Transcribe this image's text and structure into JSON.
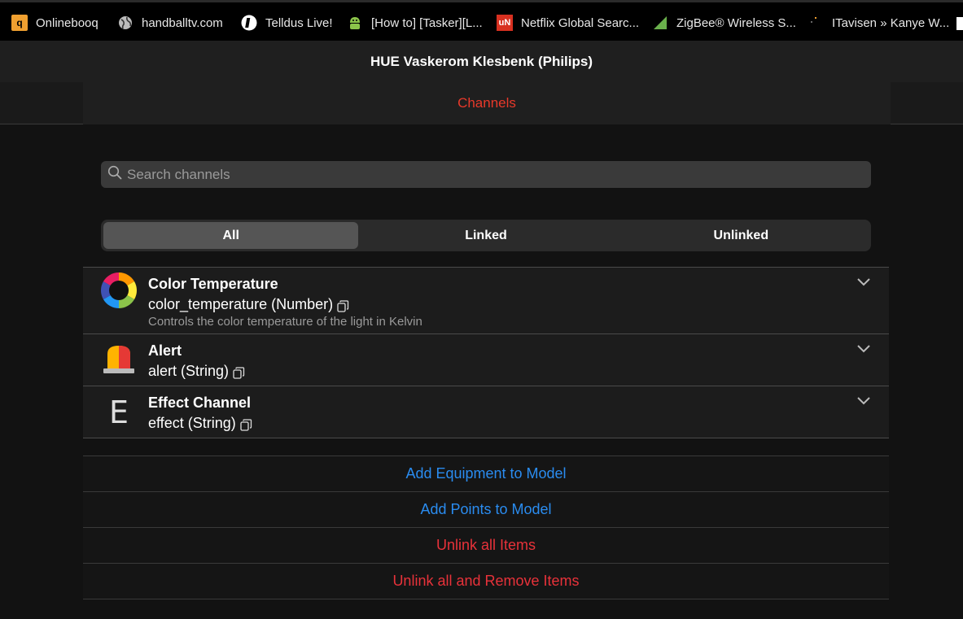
{
  "bookmarks": [
    {
      "label": "Onlinebooq",
      "icon": "q-logo-icon",
      "color": "#f0a030"
    },
    {
      "label": "handballtv.com",
      "icon": "globe-icon",
      "color": "#cccccc"
    },
    {
      "label": "Telldus Live!",
      "icon": "telldus-logo-icon",
      "color": "#ffffff"
    },
    {
      "label": "[How to] [Tasker][L...",
      "icon": "android-icon",
      "color": "#8bc34a"
    },
    {
      "label": "Netflix Global Searc...",
      "icon": "unogs-logo-icon",
      "color": "#d83020"
    },
    {
      "label": "ZigBee® Wireless S...",
      "icon": "zigbee-logo-icon",
      "color": "#6ab04c"
    },
    {
      "label": "ITavisen » Kanye W...",
      "icon": "itavisen-logo-icon",
      "color": "#f0a030"
    }
  ],
  "titlebar": {
    "title": "HUE Vaskerom Klesbenk (Philips)"
  },
  "tabs": {
    "active": "Channels"
  },
  "search": {
    "placeholder": "Search channels"
  },
  "filter": {
    "options": [
      "All",
      "Linked",
      "Unlinked"
    ],
    "selected": "All"
  },
  "channels": [
    {
      "name": "Color Temperature",
      "uid": "color_temperature (Number)",
      "description": "Controls the color temperature of the light in Kelvin",
      "icon": "color-wheel-icon"
    },
    {
      "name": "Alert",
      "uid": "alert (String)",
      "icon": "alarm-light-icon"
    },
    {
      "name": "Effect Channel",
      "uid": "effect (String)",
      "icon": "letter-e-icon",
      "icon_text": "E"
    }
  ],
  "actions": {
    "add_equipment": "Add Equipment to Model",
    "add_points": "Add Points to Model",
    "unlink_all": "Unlink all Items",
    "unlink_remove": "Unlink all and Remove Items"
  },
  "colors": {
    "accent_red": "#e8392a",
    "link_blue": "#2a8cf0",
    "danger_red": "#e8323a"
  }
}
